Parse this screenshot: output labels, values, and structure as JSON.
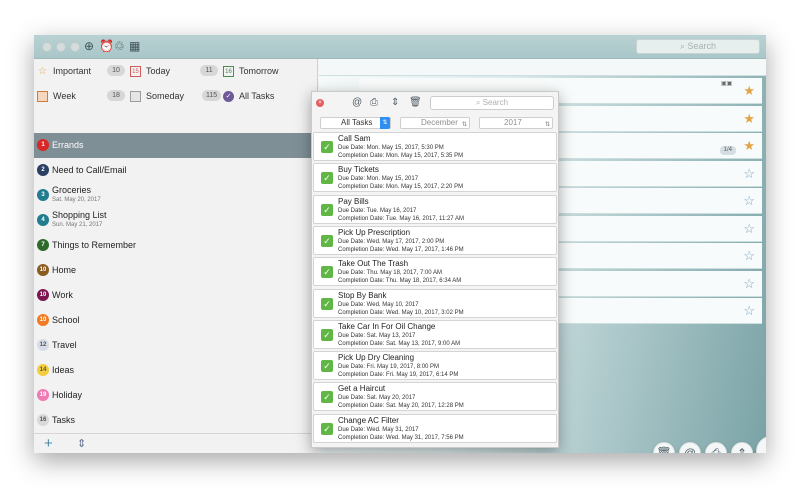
{
  "toolbar": {
    "icons": [
      "crosshair-icon",
      "alarm-clock-icon",
      "recycle-icon",
      "grid-icon"
    ],
    "search_placeholder": "Search"
  },
  "smart_lists": [
    {
      "label": "Important",
      "count": "10",
      "icon": "star-icon"
    },
    {
      "label": "Today",
      "count": "11",
      "icon": "calendar-icon",
      "icon_text": "15"
    },
    {
      "label": "Tomorrow",
      "icon": "calendar-icon",
      "icon_text": "16"
    },
    {
      "label": "Week",
      "count": "18",
      "icon": "week-calendar-icon"
    },
    {
      "label": "Someday",
      "count": "115",
      "icon": "someday-icon"
    },
    {
      "label": "All Tasks",
      "icon": "checkmark-circle-icon"
    }
  ],
  "lists": [
    {
      "num": "1",
      "name": "Errands",
      "color": "#d92626",
      "selected": true
    },
    {
      "num": "2",
      "name": "Need to Call/Email",
      "color": "#2b3f63"
    },
    {
      "num": "3",
      "name": "Groceries",
      "date": "Sat. May 20, 2017",
      "color": "#217c8f"
    },
    {
      "num": "4",
      "name": "Shopping List",
      "date": "Sun. May 21, 2017",
      "color": "#217c8f"
    },
    {
      "num": "7",
      "name": "Things to Remember",
      "color": "#2f6a2c"
    },
    {
      "num": "10",
      "name": "Home",
      "color": "#8a5c1e"
    },
    {
      "num": "10",
      "name": "Work",
      "color": "#7d1650"
    },
    {
      "num": "10",
      "name": "School",
      "color": "#f27a24"
    },
    {
      "num": "12",
      "name": "Travel",
      "color": "#d7dde8"
    },
    {
      "num": "14",
      "name": "Ideas",
      "color": "#f3cd3e"
    },
    {
      "num": "19",
      "name": "Holiday",
      "color": "#f07ab4"
    },
    {
      "num": "16",
      "name": "Tasks",
      "color": "#d9d9d9"
    }
  ],
  "sidebar_bottom": {
    "add_symbol": "+",
    "sort_symbol": "⇕"
  },
  "popup": {
    "search_placeholder": "Search",
    "filter_task": "All Tasks",
    "filter_month": "December",
    "filter_year": "2017",
    "tasks": [
      {
        "title": "Call Sam",
        "due": "Due Date: Mon. May 15, 2017, 5:30 PM",
        "completion": "Completion Date: Mon. May 15, 2017, 5:35 PM"
      },
      {
        "title": "Buy Tickets",
        "due": "Due Date: Mon. May 15, 2017",
        "completion": "Completion Date: Mon. May 15, 2017, 2:20 PM"
      },
      {
        "title": "Pay Bills",
        "due": "Due Date: Tue. May 16, 2017",
        "completion": "Completion Date: Tue. May 16, 2017, 11:27 AM"
      },
      {
        "title": "Pick Up Prescription",
        "due": "Due Date: Wed. May 17, 2017, 2:00 PM",
        "completion": "Completion Date: Wed. May 17, 2017, 1:46 PM"
      },
      {
        "title": "Take Out The Trash",
        "due": "Due Date: Thu. May 18, 2017, 7:00 AM",
        "completion": "Completion Date: Thu. May 18, 2017, 6:34 AM"
      },
      {
        "title": "Stop By Bank",
        "due": "Due Date: Wed. May 10, 2017",
        "completion": "Completion Date: Wed. May 10, 2017, 3:02 PM"
      },
      {
        "title": "Take Car In For Oil Change",
        "due": "Due Date: Sat. May 13, 2017",
        "completion": "Completion Date: Sat. May 13, 2017, 9:00 AM"
      },
      {
        "title": "Pick Up Dry Cleaning",
        "due": "Due Date: Fri. May 19, 2017, 8:00 PM",
        "completion": "Completion Date: Fri. May 19, 2017, 6:14 PM"
      },
      {
        "title": "Get a Haircut",
        "due": "Due Date: Sat. May 20, 2017",
        "completion": "Completion Date: Sat. May 20, 2017, 12:28 PM"
      },
      {
        "title": "Change AC Filter",
        "due": "Due Date: Wed. May 31, 2017",
        "completion": "Completion Date: Wed. May 31, 2017, 7:56 PM"
      }
    ]
  },
  "main": {
    "page_indicator": "1/4",
    "star_states": [
      "gold",
      "gold",
      "gold",
      "outline",
      "outline",
      "outline",
      "outline",
      "outline",
      "outline"
    ]
  },
  "fabs": [
    "trash-icon",
    "at-icon",
    "print-icon",
    "sort-icon",
    "add-icon"
  ]
}
